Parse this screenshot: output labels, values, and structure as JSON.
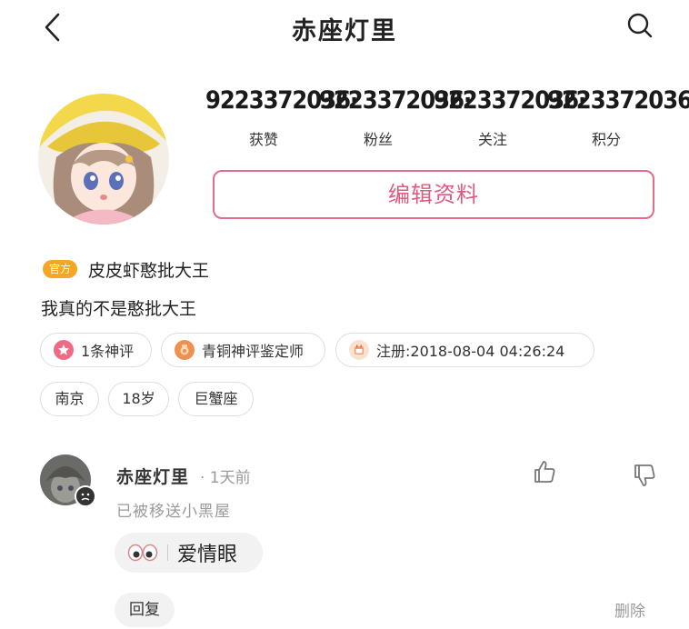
{
  "header": {
    "title": "赤座灯里"
  },
  "stats": [
    {
      "value": "9223372036·",
      "label": "获赞"
    },
    {
      "value": "9223372036·",
      "label": "粉丝"
    },
    {
      "value": "9223372036·",
      "label": "关注"
    },
    {
      "value": "9223372036·",
      "label": "积分"
    }
  ],
  "profile": {
    "edit_label": "编辑资料",
    "badge": "官方",
    "username": "皮皮虾憨批大王",
    "bio": "我真的不是憨批大王"
  },
  "pills": [
    {
      "label": "1条神评",
      "icon": "star-badge-icon",
      "color": "#f06a86"
    },
    {
      "label": "青铜神评鉴定师",
      "icon": "bronze-medal-icon",
      "color": "#f09050"
    },
    {
      "label": "注册:2018-08-04 04:26:24",
      "icon": "calendar-icon",
      "color": "#f0a070"
    }
  ],
  "tags": [
    "南京",
    "18岁",
    "巨蟹座"
  ],
  "comment": {
    "name": "赤座灯里",
    "time": "· 1天前",
    "status": "已被移送小黑屋",
    "emoji_label": "爱情眼",
    "reply_label": "回复",
    "delete_label": "删除"
  },
  "colors": {
    "accent": "#e36b8b",
    "badge": "#f5a623",
    "muted": "#9a9a9a"
  }
}
